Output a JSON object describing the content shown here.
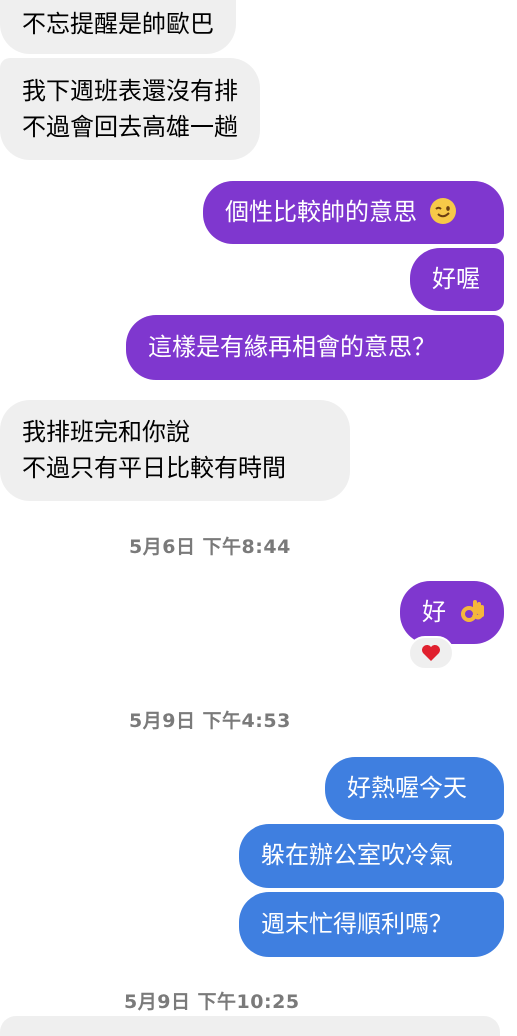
{
  "messages": [
    {
      "lines": [
        "不忘提醒是帥歐巴"
      ]
    },
    {
      "lines": [
        "我下週班表還沒有排",
        "不過會回去高雄一趟"
      ]
    },
    {
      "text": "個性比較帥的意思",
      "emoji": "winking-face-emoji"
    },
    {
      "text": "好喔"
    },
    {
      "text": "這樣是有緣再相會的意思？"
    },
    {
      "lines": [
        "我排班完和你說",
        "不過只有平日比較有時間"
      ]
    },
    {
      "text": "好",
      "emoji": "ok-hand-emoji"
    },
    {
      "text": "好熱喔今天"
    },
    {
      "text": "躲在辦公室吹冷氣"
    },
    {
      "text": "週末忙得順利嗎？"
    }
  ],
  "timestamps": [
    "5月6日 下午8:44",
    "5月9日 下午4:53",
    "5月9日 下午10:25"
  ],
  "reaction": {
    "icon": "red-heart-icon"
  },
  "colors": {
    "incoming_bubble": "#efefef",
    "outgoing_purple": "#7f37cf",
    "outgoing_blue": "#3f7fe0",
    "timestamp": "#7a7a7a"
  }
}
